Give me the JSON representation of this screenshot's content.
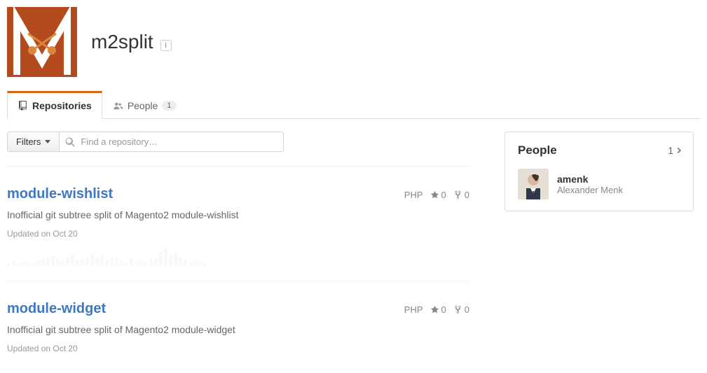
{
  "org": {
    "name": "m2split"
  },
  "tabs": {
    "repositories_label": "Repositories",
    "people_label": "People",
    "people_count": "1"
  },
  "filter": {
    "filters_label": "Filters",
    "search_placeholder": "Find a repository…"
  },
  "repos": [
    {
      "name": "module-wishlist",
      "language": "PHP",
      "stars": "0",
      "forks": "0",
      "description": "Inofficial git subtree split of Magento2 module-wishlist",
      "updated": "Updated on Oct 20"
    },
    {
      "name": "module-widget",
      "language": "PHP",
      "stars": "0",
      "forks": "0",
      "description": "Inofficial git subtree split of Magento2 module-widget",
      "updated": "Updated on Oct 20"
    }
  ],
  "people": {
    "heading": "People",
    "count": "1",
    "members": [
      {
        "username": "amenk",
        "fullname": "Alexander Menk"
      }
    ]
  }
}
